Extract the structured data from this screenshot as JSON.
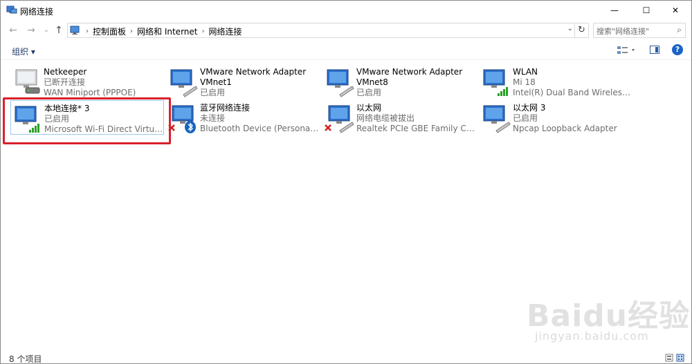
{
  "window": {
    "title": "网络连接",
    "minimize_glyph": "—",
    "maximize_glyph": "☐",
    "close_glyph": "✕"
  },
  "nav": {
    "back_glyph": "←",
    "forward_glyph": "→",
    "dropdown_glyph": "⌄",
    "up_glyph": "↑",
    "breadcrumbs": [
      "控制面板",
      "网络和 Internet",
      "网络连接"
    ],
    "breadcrumb_sep": "›",
    "refresh_glyph": "↻",
    "search_placeholder": "搜索\"网络连接\"",
    "search_glyph": "⌕"
  },
  "toolbar": {
    "organize_label": "组织 ▾",
    "help_label": "?"
  },
  "connections": [
    {
      "name": "Netkeeper",
      "status": "已断开连接",
      "device": "WAN Miniport (PPPOE)",
      "icon": "modem-icon"
    },
    {
      "name": "VMware Network Adapter VMnet1",
      "status": "已启用",
      "device": "",
      "icon": "network-adapter-icon"
    },
    {
      "name": "VMware Network Adapter VMnet8",
      "status": "已启用",
      "device": "",
      "icon": "network-adapter-icon"
    },
    {
      "name": "WLAN",
      "status": "Mi 18",
      "device": "Intel(R) Dual Band Wireless-AC...",
      "icon": "wifi-adapter-icon"
    },
    {
      "name": "本地连接* 3",
      "status": "已启用",
      "device": "Microsoft Wi-Fi Direct Virtual ...",
      "icon": "wifi-adapter-icon"
    },
    {
      "name": "蓝牙网络连接",
      "status": "未连接",
      "device": "Bluetooth Device (Personal Ar...",
      "icon": "bluetooth-adapter-icon"
    },
    {
      "name": "以太网",
      "status": "网络电缆被拔出",
      "device": "Realtek PCIe GBE Family Contr...",
      "icon": "ethernet-disconnected-icon"
    },
    {
      "name": "以太网 3",
      "status": "已启用",
      "device": "Npcap Loopback Adapter",
      "icon": "network-adapter-icon"
    }
  ],
  "status": {
    "count_label": "8 个项目"
  },
  "watermark": {
    "brand": "Baidu经验",
    "url": "jingyan.baidu.com"
  },
  "colors": {
    "highlight": "#d9202b",
    "selection": "#99c9ef",
    "link": "#1e3a6a"
  }
}
